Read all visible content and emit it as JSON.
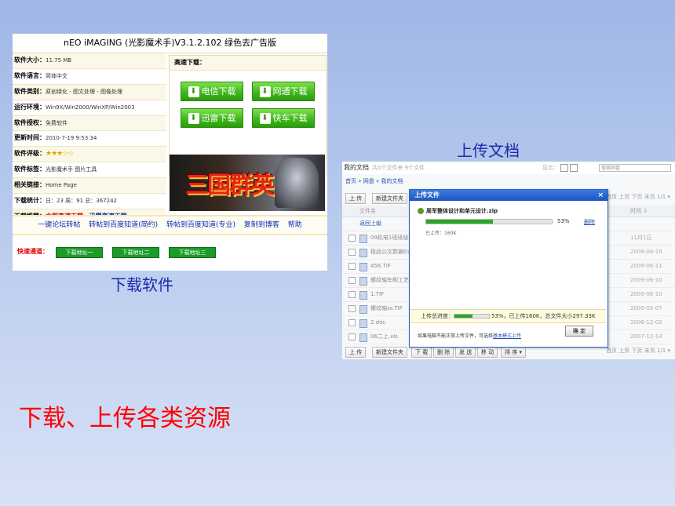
{
  "captions": {
    "upload_doc": "上传文档",
    "download_software": "下载软件",
    "main_title": "下载、上传各类资源"
  },
  "download_page": {
    "title": "nEO iMAGING (光影魔术手)V3.1.2.102 绿色去广告版",
    "info_rows": [
      {
        "key": "软件大小：",
        "value": "11.75 MB"
      },
      {
        "key": "软件语言：",
        "value": "简体中文"
      },
      {
        "key": "软件类别：",
        "value": "原创绿化 - 图文处理 - 图像处理"
      },
      {
        "key": "运行环境：",
        "value": "Win9X/Win2000/WinXP/Win2003"
      },
      {
        "key": "软件授权：",
        "value": "免费软件"
      },
      {
        "key": "更新时间：",
        "value": "2010-7-19 9:53:34"
      },
      {
        "key": "软件评级：",
        "value": "★★★☆☆"
      },
      {
        "key": "软件标签：",
        "value": "光影魔术手  图片工具"
      },
      {
        "key": "相关链接：",
        "value": "Home Page"
      },
      {
        "key": "下载统计：",
        "value": "日：23  周：91  总：367242"
      }
    ],
    "recommend_label": "下载推荐：",
    "recommend_red": "立即高速下载",
    "recommend_blue": "迅雷高速下载",
    "high_speed_label": "高速下载：",
    "buttons": {
      "telecom": "电信下载",
      "netcom": "网通下载",
      "thunder": "迅雷下载",
      "flashget": "快车下载"
    },
    "banner_text": "三国群英",
    "links": [
      "一键论坛转帖",
      "转帖到百度知道(简约)",
      "转帖到百度知道(专业)",
      "复制到博客",
      "帮助"
    ],
    "fast_label": "快速通道：",
    "fast_buttons": [
      "下载地址一",
      "下载地址二",
      "下载地址三"
    ],
    "rating_stars": 3
  },
  "upload_page": {
    "title": "我的文档",
    "subtitle": "共0个文件夹 9个文件",
    "show_label": "显示：",
    "search_placeholder": "搜索网盘",
    "breadcrumb": "首页 » 网盘 » 我的文档",
    "toolbar": {
      "upload": "上 传",
      "new_folder": "新建文件夹",
      "download": "下 载",
      "delete": "删 除",
      "send": "发 送",
      "move": "移 动",
      "sort": "排 序 ▾"
    },
    "pager": "首页  上页  下页  末页",
    "page_select": "1/1 ▾",
    "col_name": "文件名",
    "col_time": "时间 ⇩",
    "files": [
      {
        "name": "返回上级",
        "date": ""
      },
      {
        "name": "09机电1班班级课",
        "date": "11月1日"
      },
      {
        "name": "极品公文数据Dx2",
        "date": "2009-08-19"
      },
      {
        "name": "456.TIF",
        "date": "2009-06-11"
      },
      {
        "name": "螺纹轴车削工艺分",
        "date": "2009-06-10"
      },
      {
        "name": "1.TIF",
        "date": "2009-06-10"
      },
      {
        "name": "螺纹轴ss.TIF",
        "date": "2009-05-07"
      },
      {
        "name": "2.doc",
        "date": "2008-12-02"
      },
      {
        "name": "06二上.xls",
        "date": "2007-12-14"
      }
    ],
    "modal": {
      "title": "上传文件",
      "close": "×",
      "filename": "周军整体设计和单元设计.zip",
      "progress_percent": 53,
      "percent_label": "53%",
      "delete": "删除",
      "uploaded": "已上传：160K",
      "total_label": "上传总进度：",
      "total_text": "53%，已上传160K，总文件大小297.33K",
      "footer_text": "如果电脑不能正常上传文件，可选择",
      "footer_link": "基本模式上传",
      "ok": "确 定"
    }
  }
}
